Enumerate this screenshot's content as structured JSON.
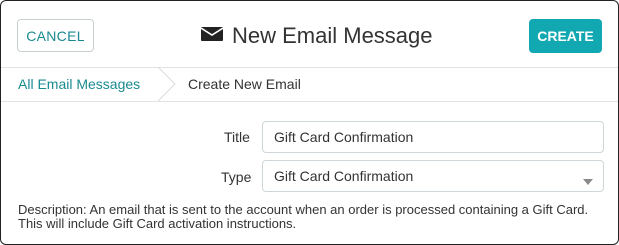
{
  "header": {
    "cancel_label": "CANCEL",
    "title": "New Email Message",
    "create_label": "CREATE",
    "title_icon": "envelope-icon"
  },
  "breadcrumb": {
    "parent": "All Email Messages",
    "current": "Create New Email"
  },
  "form": {
    "title_label": "Title",
    "title_value": "Gift Card Confirmation",
    "type_label": "Type",
    "type_value": "Gift Card Confirmation"
  },
  "description": "Description: An email that is sent to the account when an order is processed containing a Gift Card. This will include Gift Card activation instructions.",
  "colors": {
    "accent": "#12a8b1",
    "link": "#1a8a91"
  }
}
